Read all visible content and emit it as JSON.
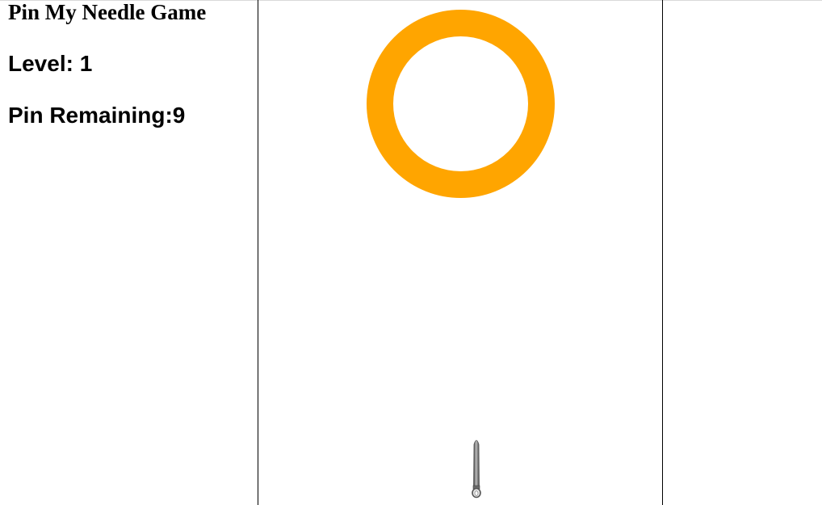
{
  "title": "Pin My Needle Game",
  "level": {
    "label": "Level:",
    "value": "1"
  },
  "pins": {
    "label": "Pin Remaining:",
    "value": "9"
  },
  "colors": {
    "ring": "#FFA500",
    "border": "#000000",
    "needle": "#808080"
  },
  "icons": {
    "target": "ring-target",
    "needle": "needle-pin-icon"
  }
}
